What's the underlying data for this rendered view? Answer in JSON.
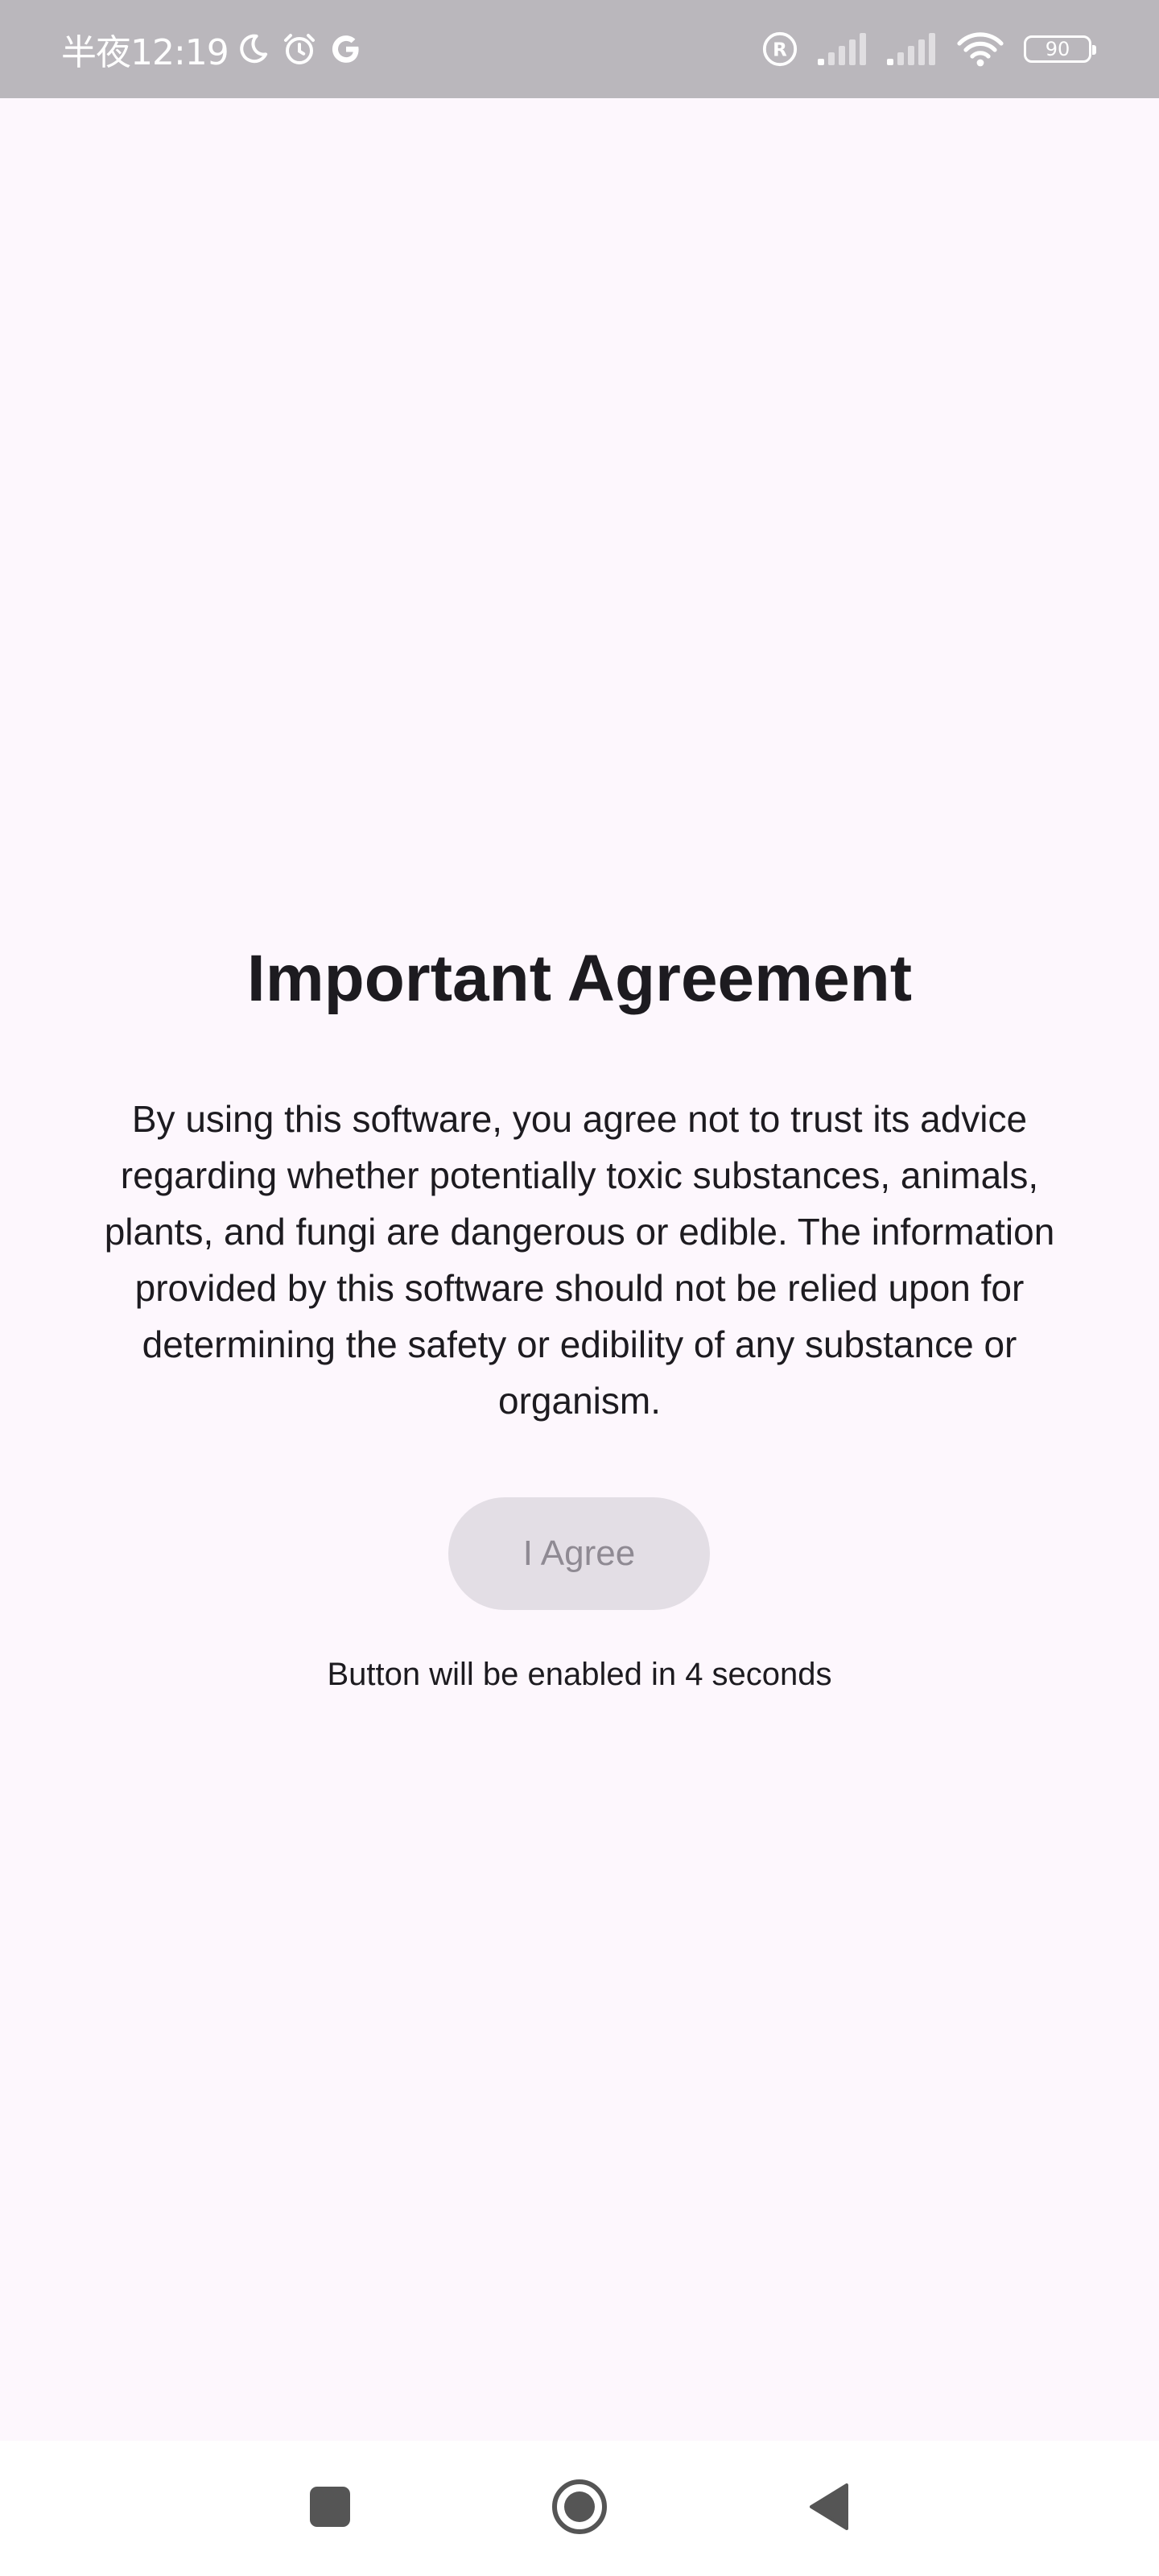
{
  "status_bar": {
    "time": "半夜12:19",
    "battery": "90",
    "icons": [
      "moon-icon",
      "alarm-icon",
      "google-icon",
      "registered-icon",
      "signal-icon",
      "signal-icon",
      "wifi-icon",
      "battery-icon"
    ]
  },
  "agreement": {
    "title": "Important Agreement",
    "body": "By using this software, you agree not to trust its advice regarding whether potentially toxic substances, animals, plants, and fungi are dangerous or edible. The information provided by this software should not be relied upon for determining the safety or edibility of any substance or organism.",
    "button_label": "I Agree",
    "button_enabled": false,
    "countdown_text": "Button will be enabled in 4 seconds"
  },
  "nav_bar": {
    "buttons": [
      "recent-apps-icon",
      "home-icon",
      "back-icon"
    ]
  },
  "colors": {
    "background": "#fdf7fd",
    "status_bar": "#bab7bc",
    "text": "#1d1b20",
    "button_disabled_bg": "#e3dee5",
    "button_disabled_text": "#8f8a93",
    "nav_icon": "#555555"
  }
}
